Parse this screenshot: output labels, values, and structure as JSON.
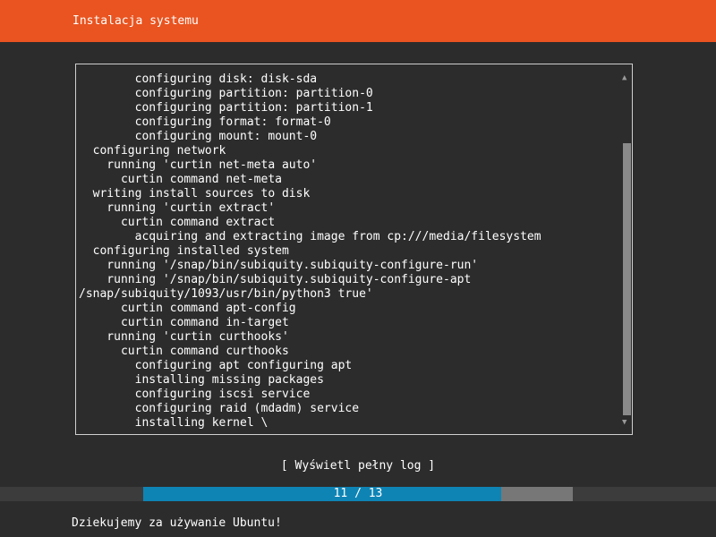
{
  "header": {
    "title": "Instalacja systemu"
  },
  "log": {
    "lines": [
      "        configuring disk: disk-sda",
      "        configuring partition: partition-0",
      "        configuring partition: partition-1",
      "        configuring format: format-0",
      "        configuring mount: mount-0",
      "  configuring network",
      "    running 'curtin net-meta auto'",
      "      curtin command net-meta",
      "  writing install sources to disk",
      "    running 'curtin extract'",
      "      curtin command extract",
      "        acquiring and extracting image from cp:///media/filesystem",
      "  configuring installed system",
      "    running '/snap/bin/subiquity.subiquity-configure-run'",
      "    running '/snap/bin/subiquity.subiquity-configure-apt",
      "/snap/subiquity/1093/usr/bin/python3 true'",
      "      curtin command apt-config",
      "      curtin command in-target",
      "    running 'curtin curthooks'",
      "      curtin command curthooks",
      "        configuring apt configuring apt",
      "        installing missing packages",
      "        configuring iscsi service",
      "        configuring raid (mdadm) service",
      "        installing kernel \\"
    ],
    "scroll_up_icon": "▲",
    "scroll_down_icon": "▼"
  },
  "full_log_button": {
    "label": "[ Wyświetl pełny log ]"
  },
  "progress": {
    "label": "11 / 13",
    "current": 11,
    "total": 13,
    "fraction": 0.8333
  },
  "footer": {
    "text": "Dziekujemy za używanie Ubuntu!"
  },
  "colors": {
    "header_bg": "#e95420",
    "background": "#2c2c2c",
    "progress_fill": "#0e84b5",
    "progress_track": "#777777"
  }
}
